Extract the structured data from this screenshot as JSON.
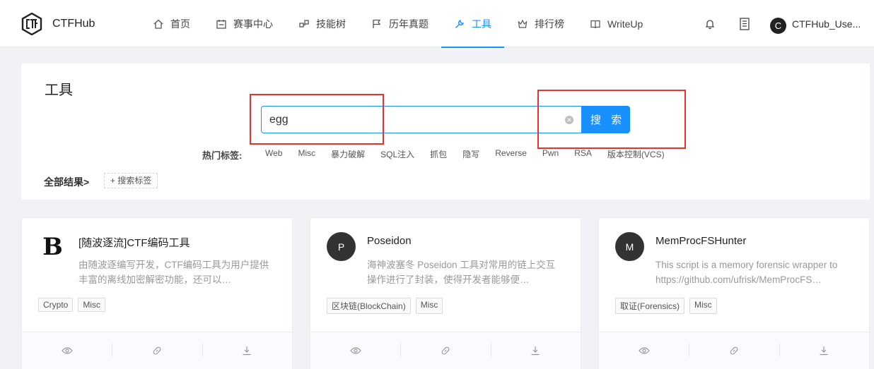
{
  "header": {
    "brand": "CTFHub",
    "nav": [
      {
        "label": "首页",
        "icon": "home-icon",
        "active": false
      },
      {
        "label": "赛事中心",
        "icon": "calendar-icon",
        "active": false
      },
      {
        "label": "技能树",
        "icon": "tree-icon",
        "active": false
      },
      {
        "label": "历年真题",
        "icon": "flag-icon",
        "active": false
      },
      {
        "label": "工具",
        "icon": "wrench-icon",
        "active": true
      },
      {
        "label": "排行榜",
        "icon": "trophy-icon",
        "active": false
      },
      {
        "label": "WriteUp",
        "icon": "book-icon",
        "active": false
      }
    ],
    "user_initial": "C",
    "username": "CTFHub_Use..."
  },
  "panel": {
    "title": "工具",
    "search_value": "egg",
    "search_button": "搜 索",
    "hot_label": "热门标签:",
    "hot_tags": [
      "Web",
      "Misc",
      "暴力破解",
      "SQL注入",
      "抓包",
      "隐写",
      "Reverse",
      "Pwn",
      "RSA",
      "版本控制(VCS)"
    ],
    "all_results": "全部结果>",
    "tag_search": "+ 搜索标签"
  },
  "cards": [
    {
      "avatar": "B",
      "title": "[随波逐流]CTF编码工具",
      "desc": "由随波逐编写开发，CTF编码工具为用户提供丰富的离线加密解密功能，还可以…",
      "tags": [
        "Crypto",
        "Misc"
      ]
    },
    {
      "avatar": "P",
      "title": "Poseidon",
      "desc": "海神波塞冬 Poseidon 工具对常用的链上交互操作进行了封装，使得开发者能够便…",
      "tags": [
        "区块链(BlockChain)",
        "Misc"
      ]
    },
    {
      "avatar": "M",
      "title": "MemProcFSHunter",
      "desc": "This script is a memory forensic wrapper to https://github.com/ufrisk/MemProcFS…",
      "tags": [
        "取证(Forensics)",
        "Misc"
      ]
    }
  ],
  "colors": {
    "accent": "#1890ff",
    "annotation": "#e5322d"
  }
}
